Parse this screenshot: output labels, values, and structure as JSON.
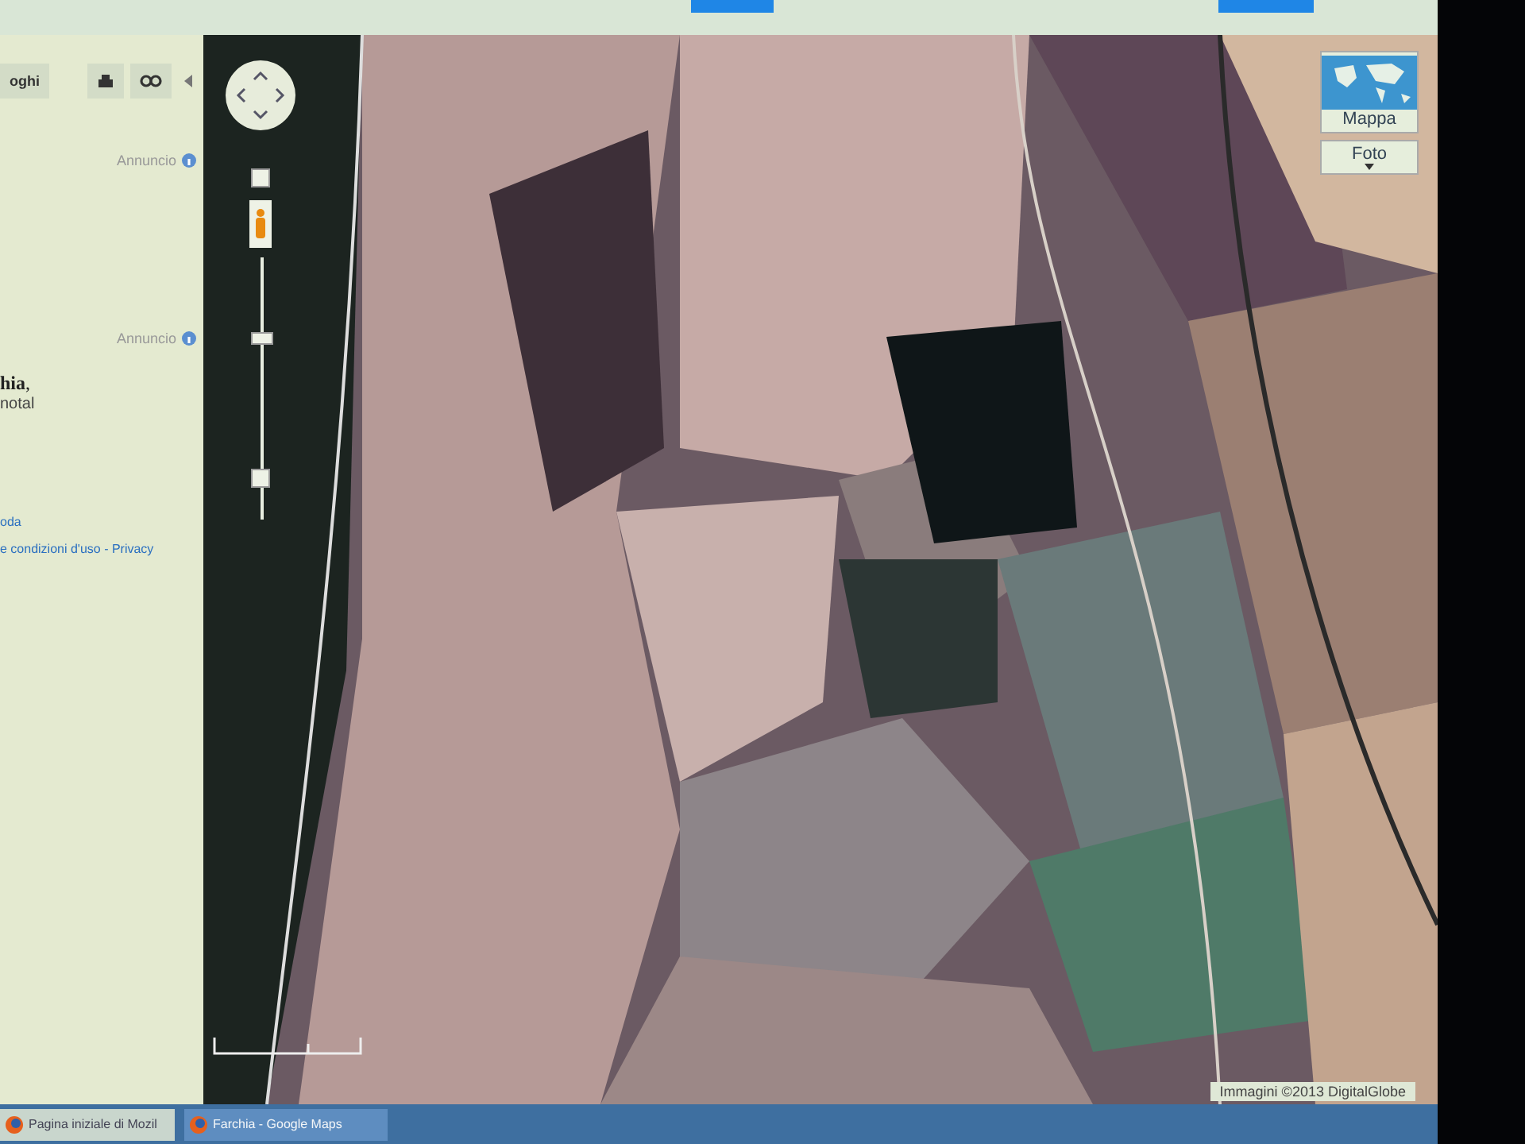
{
  "sidebar": {
    "toolbar": {
      "button_label": "oghi"
    },
    "ads": [
      {
        "label": "Annuncio"
      },
      {
        "label": "Annuncio"
      }
    ],
    "result": {
      "title": "**hia**,",
      "line": "notal"
    },
    "footer": {
      "link": "oda",
      "legal": "e condizioni d'uso - Privacy"
    }
  },
  "map": {
    "zoom": {
      "level": 0.7
    },
    "map_types": [
      {
        "label": "Mappa",
        "kind": "thumbnail"
      },
      {
        "label": "Foto",
        "kind": "dropdown"
      }
    ],
    "attribution": "Immagini ©2013 DigitalGlobe"
  },
  "taskbar": {
    "tabs": [
      {
        "label": "Pagina iniziale di Mozil",
        "selected": false
      },
      {
        "label": "Farchia - Google Maps",
        "selected": true
      }
    ]
  }
}
